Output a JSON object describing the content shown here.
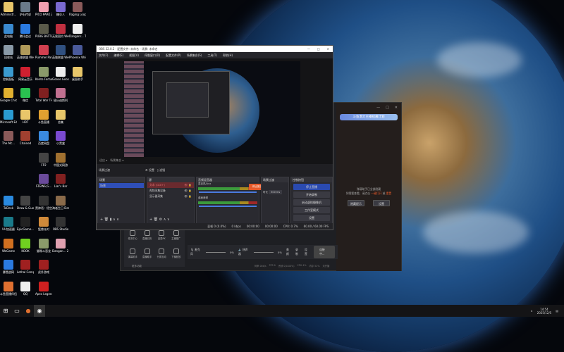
{
  "desktop": {
    "icons": [
      {
        "label": "Administr...",
        "c": "#e8c66a"
      },
      {
        "label": "炉石传说",
        "c": "#6a7a8a"
      },
      {
        "label": "PICO PARK 2",
        "c": "#f0a0b0"
      },
      {
        "label": "糖豆人",
        "c": "#7a6ad0"
      },
      {
        "label": "Raging Loop",
        "c": "#8a5a5a"
      },
      {
        "label": "此电脑",
        "c": "#3a8ad0"
      },
      {
        "label": "腾讯会议",
        "c": "#2a7ae0"
      },
      {
        "label": "PUBG BATTLEGR...",
        "c": "#5a5a4a"
      },
      {
        "label": "无畏契约 WeGame版",
        "c": "#c03040"
      },
      {
        "label": "Danganr... Trigger H...",
        "c": "#eee"
      },
      {
        "label": "回收站",
        "c": "#8a9aa8"
      },
      {
        "label": "英雄联盟 WeGame版",
        "c": "#b09a5a"
      },
      {
        "label": "Pummel Party",
        "c": "#d04050"
      },
      {
        "label": "英雄联盟 WeGame版",
        "c": "#305080"
      },
      {
        "label": "Phoenix Wright A...",
        "c": "#4a5a9a"
      },
      {
        "label": "控制面板",
        "c": "#3a9ad0"
      },
      {
        "label": "网易云音乐",
        "c": "#d02030"
      },
      {
        "label": "Kento Fortune ...",
        "c": "#8a9a6a"
      },
      {
        "label": "Goose Goose Duck",
        "c": "#eee"
      },
      {
        "label": "桌面助手",
        "c": "#e8c66a"
      },
      {
        "label": "Google Chrome",
        "c": "#e0b030"
      },
      {
        "label": "微信",
        "c": "#2ac050"
      },
      {
        "label": "Total War THREE K...",
        "c": "#802020"
      },
      {
        "label": "极乐迪斯科",
        "c": "#c07090"
      },
      {
        "label": "Microsoft Edge",
        "c": "#2a9ad0"
      },
      {
        "label": "HDT",
        "c": "#e8c66a"
      },
      {
        "label": "斗鱼直播",
        "c": "#e0a030"
      },
      {
        "label": "合集",
        "c": "#e8c66a"
      },
      {
        "label": "The Mc...",
        "c": "#8a5a5a"
      },
      {
        "label": "Chained",
        "c": "#a04030"
      },
      {
        "label": "百度网盘",
        "c": "#3a8ae0"
      },
      {
        "label": "小黑盒",
        "c": "#7a4ad0"
      },
      {
        "label": "FP2",
        "c": "#444"
      },
      {
        "label": "中国式网游",
        "c": "#a07030"
      },
      {
        "label": "STEINS;G...",
        "c": "#6a4a9a"
      },
      {
        "label": "Liar's Bar",
        "c": "#802020"
      },
      {
        "label": "ToDesk",
        "c": "#2a8ae0"
      },
      {
        "label": "Draw & Guess - ...",
        "c": "#444"
      },
      {
        "label": "黑神话：悟空",
        "c": "#333"
      },
      {
        "label": "海者生日 Demo",
        "c": "#8a6a4a"
      },
      {
        "label": "UU加速器",
        "c": "#1a7a8a"
      },
      {
        "label": "EpicGame... - 快捷方式",
        "c": "#222"
      },
      {
        "label": "猛兽派对",
        "c": "#d08a3a"
      },
      {
        "label": "OBS Studio",
        "c": "#333"
      },
      {
        "label": "WeGame",
        "c": "#d07020"
      },
      {
        "label": "KOOK",
        "c": "#70d020"
      },
      {
        "label": "猫咪斗恶龙",
        "c": "#8a9a6a"
      },
      {
        "label": "Dangan... 2 Goodb...",
        "c": "#e0a0b0"
      },
      {
        "label": "暴雪战网",
        "c": "#2a7ae0"
      },
      {
        "label": "Lethal Company",
        "c": "#a02020"
      },
      {
        "label": "虎扑游戏",
        "c": "#a02020"
      },
      {
        "label": "斗鱼直播伴侣",
        "c": "#e07030"
      },
      {
        "label": "QQ",
        "c": "#eee"
      },
      {
        "label": "Apex Legends",
        "c": "#d02020"
      }
    ]
  },
  "obs": {
    "title": "OBS 32.0.2 - 配置文件: 未命名 - 场景: 未命名",
    "menu": [
      "文件(F)",
      "编辑(E)",
      "视图(V)",
      "停靠窗口(D)",
      "配置文件(P)",
      "场景集合(S)",
      "工具(T)",
      "帮助(H)"
    ],
    "toolbar": {
      "zoom": "适应",
      "scene_label": "场景集合"
    },
    "transition_label": "场景过渡",
    "settings_tab": "设置",
    "filters_tab": "滤镜",
    "docks": {
      "scenes": {
        "title": "场景",
        "items": [
          "场景"
        ]
      },
      "sources": {
        "title": "源",
        "items": [
          "文本 (GDI+)",
          "视频采集设备",
          "显示器采集"
        ]
      },
      "mixer": {
        "title": "音频混音器",
        "channels": [
          {
            "name": "麦克风/Aux",
            "db": "0.0 dB"
          },
          {
            "name": "桌面音频",
            "db": "0.0 dB"
          }
        ]
      },
      "transitions": {
        "title": "场景过渡",
        "duration_label": "时长",
        "duration": "300 ms"
      },
      "controls": {
        "title": "控制按钮",
        "buttons": [
          "停止直播",
          "开始录制",
          "启动虚拟摄像机",
          "工作室模式",
          "设置"
        ]
      }
    },
    "toast": "停止推流，请确认",
    "status": {
      "dropped": "丢帧 0 (0.0%)",
      "bitrate": "0 kbps",
      "live_time": "00:00:00",
      "rec_time": "00:00:00",
      "cpu": "CPU: 0.7%",
      "fps": "60.00 / 60.00 FPS"
    }
  },
  "streamer_app": {
    "tools": [
      "任务中心",
      "直播日历",
      "连麦PK",
      "主播推广",
      "弹幕助手",
      "直播助手",
      "分屏互动",
      "下播回放"
    ],
    "more": "更多功能",
    "mic_label": "麦克风",
    "mic_level": "0%",
    "speaker_label": "扬声器",
    "speaker_level": "0%",
    "actions": [
      "美颜",
      "录制",
      "设置"
    ],
    "connect": "连接中...",
    "stats": [
      "码率 0kb/s",
      "FPS 0",
      "丢帧 0(0.00%)",
      "CPU 4%",
      "内存 52%",
      "未开播"
    ],
    "banner": "斗鱼潜力主播招募计划",
    "notice": "弹幕助手已全部隐藏",
    "notice2": "如需要查看，请点击 ",
    "link": "一键打开",
    "or": " 或 ",
    "link2": "重置",
    "buttons": [
      "隐藏提示",
      "设置"
    ]
  },
  "taskbar": {
    "time": "14:54",
    "date": "2025/12/5"
  },
  "colors": {
    "accent": "#2f4fb8",
    "toast": "#e85a2a",
    "primary": "#2a4ab0"
  }
}
